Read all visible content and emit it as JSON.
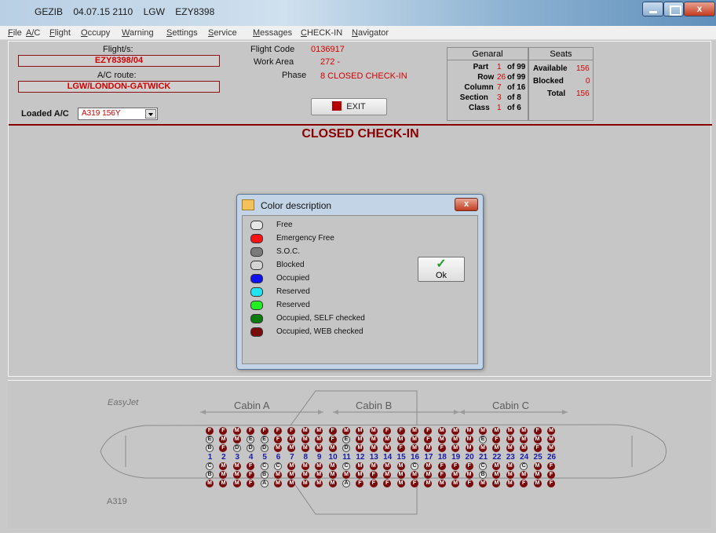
{
  "window": {
    "title_parts": [
      "GEZIB",
      "04.07.15 2110",
      "LGW",
      "EZY8398"
    ],
    "close_glyph": "x"
  },
  "menu": [
    "File",
    "A/C",
    "Flight",
    "Occupy",
    "Warning",
    "Settings",
    "Service",
    "Messages",
    "CHECK-IN",
    "Navigator"
  ],
  "info": {
    "flights_label": "Flight/s:",
    "flights_value": "EZY8398/04",
    "route_label": "A/C route:",
    "route_value": "LGW/LONDON-GATWICK",
    "loaded_label": "Loaded A/C",
    "loaded_value": "A319 156Y",
    "flight_code_label": "Flight Code",
    "flight_code_value": "0136917",
    "work_area_label": "Work Area",
    "work_area_value": "272  -",
    "phase_label": "Phase",
    "phase_value": "8  CLOSED CHECK-IN",
    "exit_label": "EXIT",
    "closed_banner": "CLOSED CHECK-IN"
  },
  "general": {
    "title": "Genaral",
    "rows": [
      {
        "label": "Part",
        "value": "1",
        "of": "of 99"
      },
      {
        "label": "Row",
        "value": "26",
        "of": "of 99"
      },
      {
        "label": "Column",
        "value": "7",
        "of": "of 16"
      },
      {
        "label": "Section",
        "value": "3",
        "of": "of  8"
      },
      {
        "label": "Class",
        "value": "1",
        "of": "of  6"
      }
    ]
  },
  "seats": {
    "title": "Seats",
    "rows": [
      {
        "label": "Available",
        "value": "156"
      },
      {
        "label": "Blocked",
        "value": "0"
      },
      {
        "label": "Total",
        "value": "156"
      }
    ]
  },
  "dialog": {
    "title": "Color description",
    "close_glyph": "x",
    "ok_label": "Ok",
    "ok_icon": "check-icon",
    "items": [
      {
        "label": "Free",
        "color": "#e6e6e6"
      },
      {
        "label": "Emergency Free",
        "color": "#ff1010"
      },
      {
        "label": "S.O.C.",
        "color": "#7a7a7a"
      },
      {
        "label": "Blocked",
        "color": "#d4d4d4"
      },
      {
        "label": "Occupied",
        "color": "#1010ee"
      },
      {
        "label": "Reserved",
        "color": "#22e4f0"
      },
      {
        "label": "Reserved",
        "color": "#22ee22"
      },
      {
        "label": "Occupied, SELF checked",
        "color": "#0a7a0a"
      },
      {
        "label": "Occupied, WEB checked",
        "color": "#7a0a0a"
      }
    ]
  },
  "aircraft": {
    "brand": "EasyJet",
    "type": "A319",
    "cabins": [
      "Cabin A",
      "Cabin B",
      "Cabin C"
    ],
    "row_numbers": [
      "1",
      "2",
      "3",
      "4",
      "5",
      "6",
      "7",
      "8",
      "9",
      "10",
      "11",
      "12",
      "13",
      "14",
      "15",
      "16",
      "17",
      "18",
      "19",
      "20",
      "21",
      "22",
      "23",
      "24",
      "25",
      "26"
    ],
    "seat_rows": [
      "FFMFFFFMMFMMMFFMFMMMMMMMFM",
      "EMMEEFMMMFEMMMMMFMMMEFMMMM",
      "BFDDDMMMMMDMMMFMMFMMMMMMFM",
      "CMMFCCMMMMCMMMMCMFFFCMMCMF",
      "BMMFBMMMMMMMFMMMMFMMBMMMMF",
      "MMMFAMMMMMAFFFMFMMMFMMMFMF"
    ],
    "seat_colors": {
      "F": "#7a0a0a",
      "M": "#7a0a0a",
      "E": "#d7d7d7",
      "B": "#e6e6e6",
      "D": "#d7d7d7",
      "C": "#e6e6e6",
      "A": "#e6e6e6"
    }
  }
}
